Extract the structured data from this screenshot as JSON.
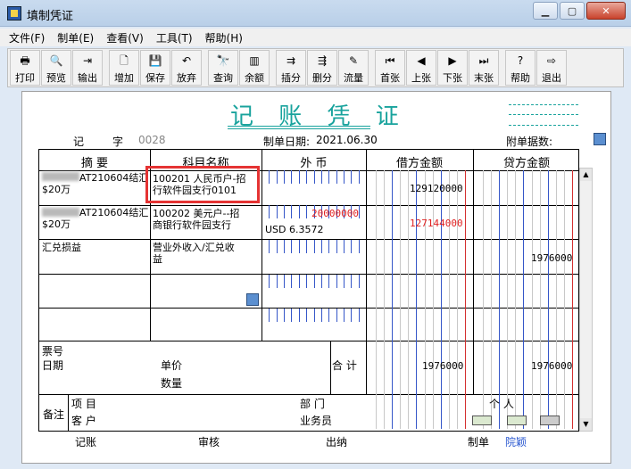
{
  "window": {
    "title": "填制凭证"
  },
  "menu": [
    "文件(F)",
    "制单(E)",
    "查看(V)",
    "工具(T)",
    "帮助(H)"
  ],
  "toolbar": {
    "g1": [
      {
        "label": "打印",
        "icon": "printer-icon",
        "glyph": "🖶"
      },
      {
        "label": "预览",
        "icon": "preview-icon",
        "glyph": "🔍"
      },
      {
        "label": "输出",
        "icon": "export-icon",
        "glyph": "⇥"
      }
    ],
    "g2": [
      {
        "label": "增加",
        "icon": "new-doc-icon",
        "glyph": "🗋"
      },
      {
        "label": "保存",
        "icon": "save-icon",
        "glyph": "💾"
      },
      {
        "label": "放弃",
        "icon": "undo-icon",
        "glyph": "↶"
      }
    ],
    "g3": [
      {
        "label": "查询",
        "icon": "binoculars-icon",
        "glyph": "🔭"
      },
      {
        "label": "余额",
        "icon": "bar-chart-icon",
        "glyph": "▥"
      }
    ],
    "g4": [
      {
        "label": "插分",
        "icon": "insert-entry-icon",
        "glyph": "⇉"
      },
      {
        "label": "删分",
        "icon": "delete-entry-icon",
        "glyph": "⇶"
      },
      {
        "label": "流量",
        "icon": "flow-icon",
        "glyph": "✎"
      }
    ],
    "g5": [
      {
        "label": "首张",
        "icon": "first-icon",
        "glyph": "⏮"
      },
      {
        "label": "上张",
        "icon": "prev-icon",
        "glyph": "◀"
      },
      {
        "label": "下张",
        "icon": "next-icon",
        "glyph": "▶"
      },
      {
        "label": "末张",
        "icon": "last-icon",
        "glyph": "⏭"
      }
    ],
    "g6": [
      {
        "label": "帮助",
        "icon": "help-icon",
        "glyph": "?"
      },
      {
        "label": "退出",
        "icon": "exit-icon",
        "glyph": "⇨"
      }
    ]
  },
  "voucher": {
    "title": "记 账 凭 证",
    "type_label": "记",
    "number_label": "字",
    "number": "0028",
    "date_label": "制单日期:",
    "date": "2021.06.30",
    "attach_label": "附单据数:",
    "headers": {
      "summary": "摘 要",
      "account": "科目名称",
      "foreign": "外 币",
      "debit": "借方金额",
      "credit": "贷方金额"
    },
    "rows": [
      {
        "summary_1": "AT210604结汇",
        "summary_2": "$20万",
        "account_1": "100201 人民币户-招",
        "account_2": "行软件园支行0101",
        "foreign_amount": "",
        "rate": "",
        "debit": "129120000",
        "credit": ""
      },
      {
        "summary_1": "AT210604结汇",
        "summary_2": "$20万",
        "account_1": "100202 美元户--招",
        "account_2": "商银行软件园支行",
        "foreign_amount": "20000000",
        "rate": "USD 6.3572",
        "debit": "127144000",
        "credit": ""
      },
      {
        "summary_1": "汇兑损益",
        "summary_2": "",
        "account_1": "营业外收入/汇兑收",
        "account_2": "益",
        "foreign_amount": "",
        "rate": "",
        "debit": "",
        "credit": "1976000"
      }
    ],
    "bottom": {
      "ticket_no": "票号",
      "date": "日期",
      "unit_price": "单价",
      "quantity": "数量",
      "total_label": "合 计",
      "total_debit": "1976000",
      "total_credit": "1976000",
      "remark": "备注",
      "project": "项 目",
      "customer": "客 户",
      "department": "部 门",
      "salesman": "业务员",
      "person": "个 人"
    },
    "footer": {
      "bookkeep": "记账",
      "review": "审核",
      "cashier": "出纳",
      "maker_label": "制单",
      "maker": "院颖"
    }
  },
  "colors": {
    "title": "#19a39d",
    "amount_red": "#e02020",
    "highlight": "#e53333",
    "maker": "#2a58d0"
  }
}
